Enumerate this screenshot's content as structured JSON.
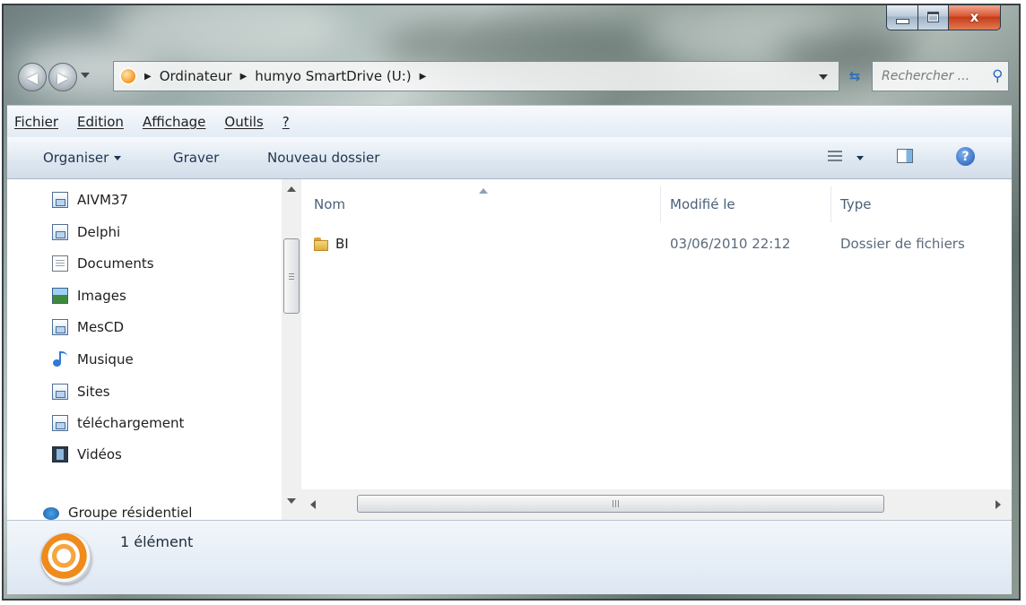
{
  "window": {
    "caption": {
      "minimize": "",
      "maximize": "",
      "close": "x"
    }
  },
  "navigation": {
    "breadcrumbs": [
      "Ordinateur",
      "humyo SmartDrive (U:)"
    ],
    "search_placeholder": "Rechercher ..."
  },
  "menu": {
    "items": [
      "Fichier",
      "Edition",
      "Affichage",
      "Outils",
      "?"
    ]
  },
  "toolbar": {
    "organiser": "Organiser",
    "graver": "Graver",
    "nouveau_dossier": "Nouveau dossier"
  },
  "tree": {
    "items": [
      {
        "label": "AIVM37",
        "icon": "network-drive-icon"
      },
      {
        "label": "Delphi",
        "icon": "network-drive-icon"
      },
      {
        "label": "Documents",
        "icon": "documents-icon"
      },
      {
        "label": "Images",
        "icon": "images-icon"
      },
      {
        "label": "MesCD",
        "icon": "network-drive-icon"
      },
      {
        "label": "Musique",
        "icon": "music-icon"
      },
      {
        "label": "Sites",
        "icon": "network-drive-icon"
      },
      {
        "label": "téléchargement",
        "icon": "network-drive-icon"
      },
      {
        "label": "Vidéos",
        "icon": "videos-icon"
      }
    ],
    "partial": "Groupe résidentiel"
  },
  "list": {
    "columns": [
      "Nom",
      "Modifié le",
      "Type"
    ],
    "rows": [
      {
        "name": "BI",
        "modified": "03/06/2010 22:12",
        "type": "Dossier de fichiers"
      }
    ]
  },
  "details": {
    "count": "1 élément"
  },
  "colors": {
    "accent": "#2a6bc2",
    "close_button": "#d9542f",
    "column_header": "#4c607a"
  }
}
